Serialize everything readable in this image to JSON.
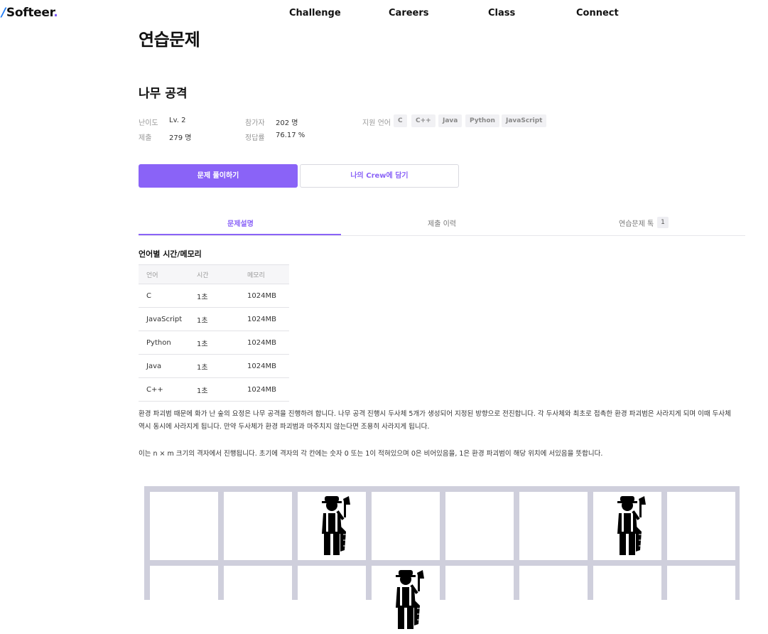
{
  "brand": {
    "logo_slash": "/",
    "logo_text": "Softeer",
    "logo_dot": "."
  },
  "nav": [
    "Challenge",
    "Careers",
    "Class",
    "Connect"
  ],
  "page_title": "연습문제",
  "problem": {
    "title": "나무 공격",
    "difficulty_label": "난이도",
    "difficulty_value": "Lv. 2",
    "submissions_label": "제출",
    "submissions_value": "279 명",
    "participants_label": "참가자",
    "participants_value": "202 명",
    "accuracy_label": "정답률",
    "accuracy_value": "76.17 %",
    "languages_label": "지원 언어",
    "languages": [
      "C",
      "C++",
      "Java",
      "Python",
      "JavaScript"
    ]
  },
  "buttons": {
    "solve": "문제 풀이하기",
    "add_crew": "나의 Crew에 담기"
  },
  "tabs": {
    "description": "문제설명",
    "history": "제출 이력",
    "talk": "연습문제 톡",
    "talk_count": "1"
  },
  "limits": {
    "title": "언어별 시간/메모리",
    "headers": [
      "언어",
      "시간",
      "메모리"
    ],
    "rows": [
      [
        "C",
        "1초",
        "1024MB"
      ],
      [
        "JavaScript",
        "1초",
        "1024MB"
      ],
      [
        "Python",
        "1초",
        "1024MB"
      ],
      [
        "Java",
        "1초",
        "1024MB"
      ],
      [
        "C++",
        "1초",
        "1024MB"
      ]
    ]
  },
  "description": {
    "p1_line1": "환경 파괴범 때문에 화가 난 숲의 요정은 나무 공격을 진행하려 합니다. 나무 공격 진행시 두사체 5개가 생성되어 지정된 방향으로 전진합니다. 각 두사체와 최초로 접촉한 환경 파괴범은 사라지게 되며 이때 두사체",
    "p1_line2": "역시 동시에 사라지게 됩니다. 만약 두사체가 환경 파괴범과 마주치지 않는다면 조용히 사라지게 됩니다.",
    "p2": "이는 n × m 크기의 격자에서 진행됩니다. 초기에 격자의 각 칸에는 숫자 0 또는 1이 적혀있으며 0은 비어있음을, 1은 환경 파괴범이 해당 위치에 서있음을 뜻합니다."
  },
  "grid": {
    "rows": [
      [
        0,
        0,
        1,
        0,
        0,
        0,
        1,
        0
      ],
      [
        0,
        0,
        0,
        1,
        0,
        0,
        0,
        0
      ]
    ]
  }
}
